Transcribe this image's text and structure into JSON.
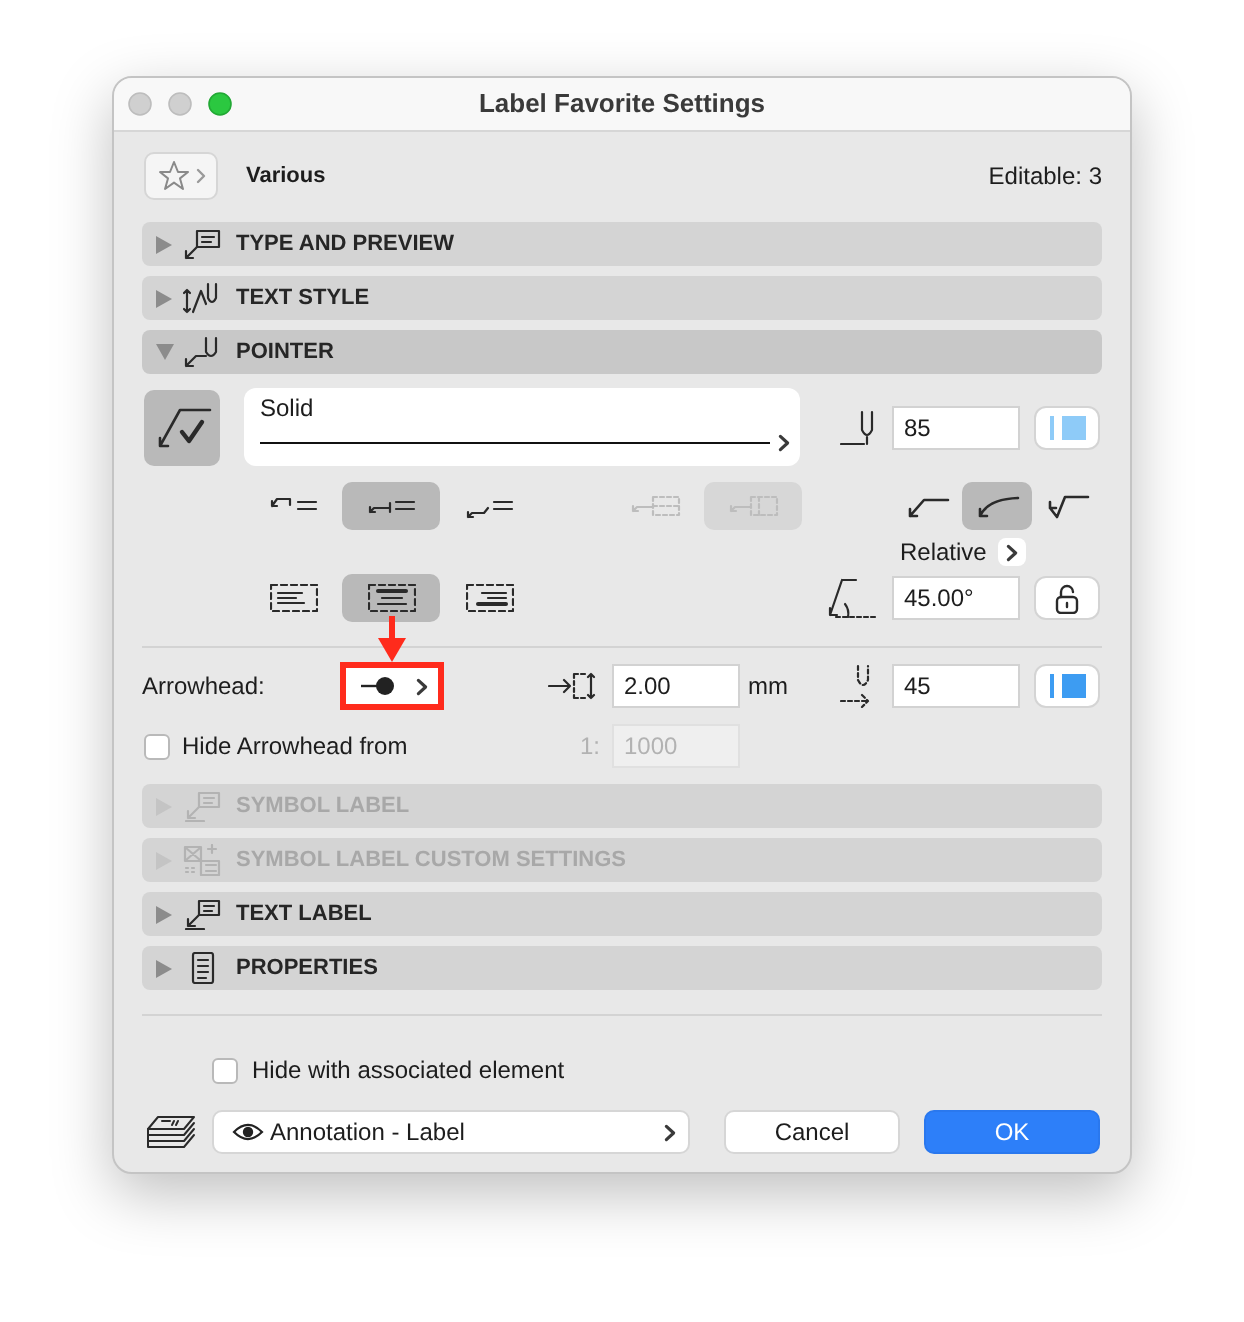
{
  "window": {
    "title": "Label Favorite Settings"
  },
  "header": {
    "favorite_name": "Various",
    "editable_count": "Editable: 3"
  },
  "sections": [
    {
      "kind": "type",
      "title": "TYPE AND PREVIEW",
      "expanded": false,
      "disabled": false
    },
    {
      "kind": "textstyle",
      "title": "TEXT STYLE",
      "expanded": false,
      "disabled": false
    },
    {
      "kind": "pointer",
      "title": "POINTER",
      "expanded": true,
      "disabled": false,
      "content": {
        "line_type": "Solid",
        "line_pen": "85",
        "pointer_styles": [
          {
            "kind": "hook",
            "selected": false,
            "disabled": false
          },
          {
            "kind": "level",
            "selected": true,
            "disabled": false
          },
          {
            "kind": "drop",
            "selected": false,
            "disabled": false
          },
          {
            "kind": "frame",
            "selected": false,
            "disabled": true
          },
          {
            "kind": "frameline",
            "selected": true,
            "disabled": true
          }
        ],
        "line_shapes": [
          {
            "kind": "straight",
            "selected": false
          },
          {
            "kind": "curved",
            "selected": true
          },
          {
            "kind": "bent",
            "selected": false
          }
        ],
        "angle_mode": "Relative",
        "alignments": [
          {
            "kind": "left",
            "selected": false
          },
          {
            "kind": "center",
            "selected": true
          },
          {
            "kind": "right",
            "selected": false
          }
        ],
        "angle": "45.00°",
        "arrowhead": {
          "label": "Arrowhead:",
          "size": "2.00",
          "unit": "mm",
          "pen": "45"
        },
        "hide_arrowhead": {
          "label": "Hide Arrowhead from",
          "checked": false,
          "scale_prefix": "1:",
          "scale": "1000",
          "scale_disabled": true
        }
      }
    },
    {
      "kind": "symbol",
      "title": "SYMBOL LABEL",
      "expanded": false,
      "disabled": true
    },
    {
      "kind": "custom",
      "title": "SYMBOL LABEL CUSTOM SETTINGS",
      "expanded": false,
      "disabled": true
    },
    {
      "kind": "textlabel",
      "title": "TEXT LABEL",
      "expanded": false,
      "disabled": false
    },
    {
      "kind": "properties",
      "title": "PROPERTIES",
      "expanded": false,
      "disabled": false
    }
  ],
  "footer": {
    "hide_with_element": {
      "label": "Hide with associated element",
      "checked": false
    },
    "layer": "Annotation - Label",
    "buttons": [
      {
        "kind": "cancel",
        "label": "Cancel"
      },
      {
        "kind": "default",
        "label": "OK"
      }
    ]
  }
}
